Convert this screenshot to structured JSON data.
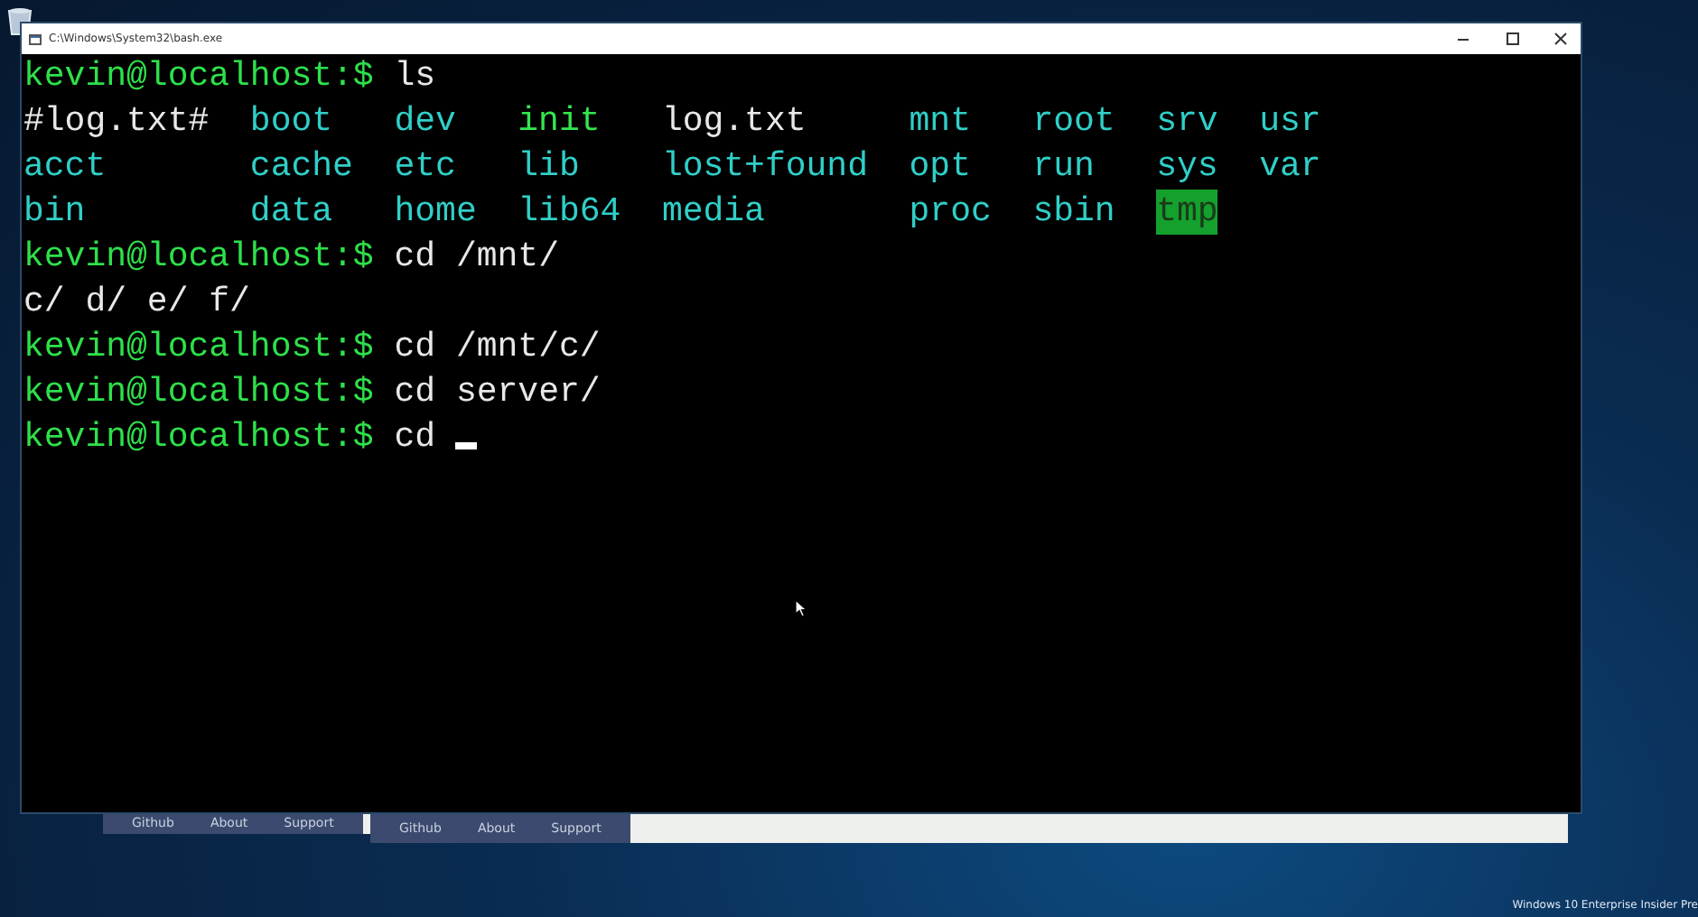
{
  "background_windows": [
    {
      "nav_links": [
        "Github",
        "About",
        "Support"
      ]
    },
    {
      "nav_links": [
        "Github",
        "About",
        "Support"
      ]
    }
  ],
  "terminal": {
    "title": "C:\\Windows\\System32\\bash.exe",
    "lines": [
      {
        "kind": "prompt",
        "prompt": "kevin@localhost:$",
        "command": "ls",
        "cursor": false
      },
      {
        "kind": "listing",
        "entries": [
          {
            "text": "#log.txt#",
            "kind": "file"
          },
          {
            "text": "boot",
            "kind": "dir"
          },
          {
            "text": "dev",
            "kind": "dir"
          },
          {
            "text": "init",
            "kind": "exec"
          },
          {
            "text": "log.txt",
            "kind": "file"
          },
          {
            "text": "mnt",
            "kind": "dir"
          },
          {
            "text": "root",
            "kind": "dir"
          },
          {
            "text": "srv",
            "kind": "dir"
          },
          {
            "text": "usr",
            "kind": "dir"
          },
          {
            "text": "acct",
            "kind": "dir"
          },
          {
            "text": "cache",
            "kind": "dir"
          },
          {
            "text": "etc",
            "kind": "dir"
          },
          {
            "text": "lib",
            "kind": "dir"
          },
          {
            "text": "lost+found",
            "kind": "dir"
          },
          {
            "text": "opt",
            "kind": "dir"
          },
          {
            "text": "run",
            "kind": "dir"
          },
          {
            "text": "sys",
            "kind": "dir"
          },
          {
            "text": "var",
            "kind": "dir"
          },
          {
            "text": "bin",
            "kind": "dir"
          },
          {
            "text": "data",
            "kind": "dir"
          },
          {
            "text": "home",
            "kind": "dir"
          },
          {
            "text": "lib64",
            "kind": "dir"
          },
          {
            "text": "media",
            "kind": "dir"
          },
          {
            "text": "proc",
            "kind": "dir"
          },
          {
            "text": "sbin",
            "kind": "dir"
          },
          {
            "text": "tmp",
            "kind": "sticky"
          }
        ]
      },
      {
        "kind": "prompt",
        "prompt": "kevin@localhost:$",
        "command": "cd /mnt/",
        "cursor": false
      },
      {
        "kind": "output",
        "text": "c/ d/ e/ f/"
      },
      {
        "kind": "prompt",
        "prompt": "kevin@localhost:$",
        "command": "cd /mnt/c/",
        "cursor": false
      },
      {
        "kind": "prompt",
        "prompt": "kevin@localhost:$",
        "command": "cd server/",
        "cursor": false
      },
      {
        "kind": "prompt",
        "prompt": "kevin@localhost:$",
        "command": "cd",
        "cursor": true
      }
    ]
  },
  "edition_text": "Windows 10 Enterprise Insider Pre"
}
